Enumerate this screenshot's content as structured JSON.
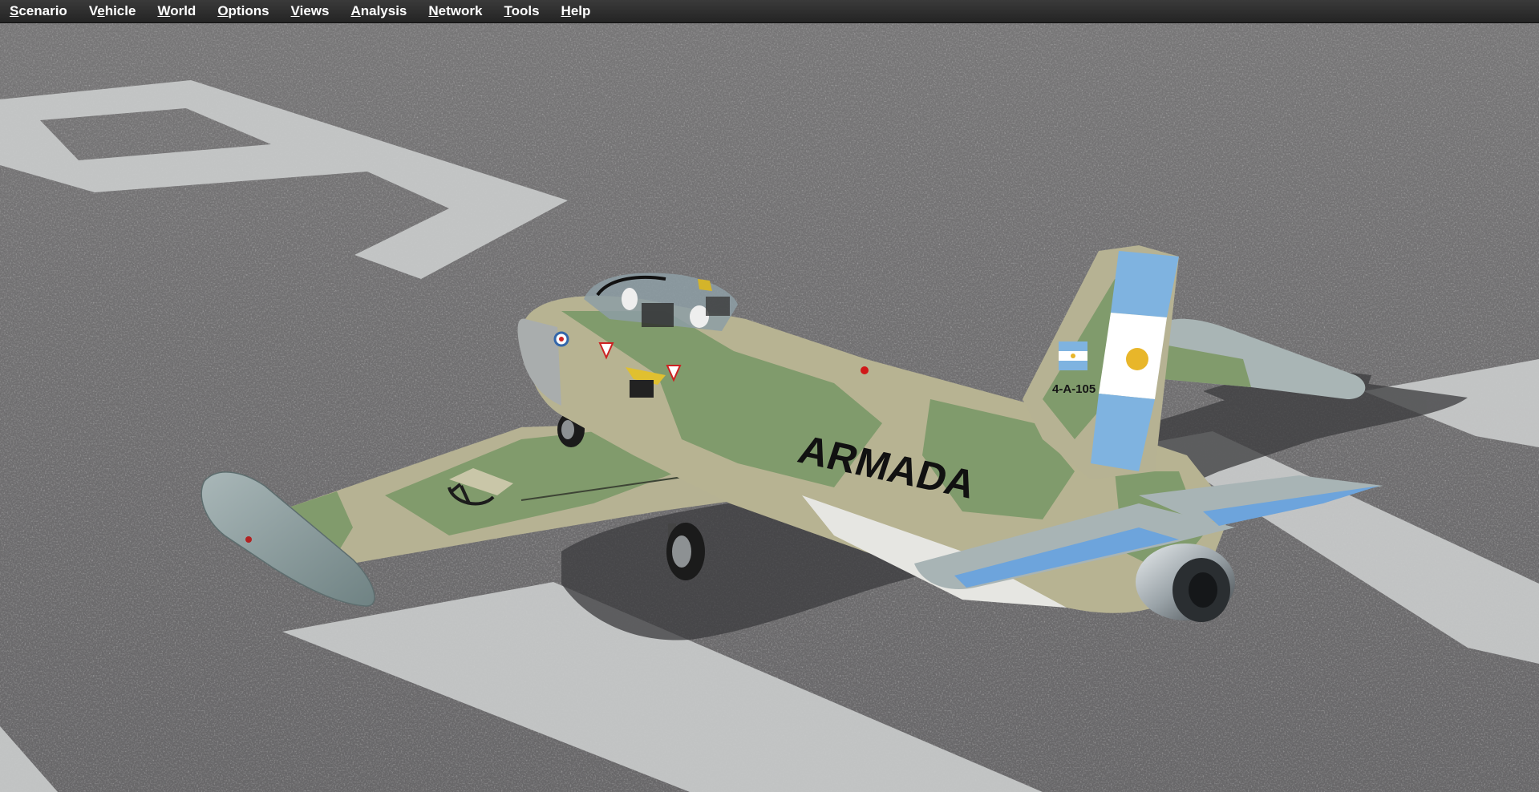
{
  "menubar": {
    "items": [
      {
        "accel": "S",
        "rest": "cenario"
      },
      {
        "accel": "Ve",
        "rest": "hicle",
        "accel_pos": 1
      },
      {
        "accel": "W",
        "rest": "orld"
      },
      {
        "accel": "O",
        "rest": "ptions"
      },
      {
        "accel": "V",
        "rest": "iews"
      },
      {
        "accel": "A",
        "rest": "nalysis"
      },
      {
        "accel": "N",
        "rest": "etwork"
      },
      {
        "accel": "T",
        "rest": "ools"
      },
      {
        "accel": "H",
        "rest": "elp"
      }
    ],
    "labels": [
      "Scenario",
      "Vehicle",
      "World",
      "Options",
      "Views",
      "Analysis",
      "Network",
      "Tools",
      "Help"
    ]
  },
  "aircraft": {
    "fuselage_text": "ARMADA",
    "tail_code": "4-A-105",
    "colors": {
      "camo_green": "#7f9a6c",
      "camo_tan": "#b7b392",
      "flag_blue": "#7fb3e0",
      "tarmac": "#737273",
      "marking": "#c9cbcb"
    }
  }
}
